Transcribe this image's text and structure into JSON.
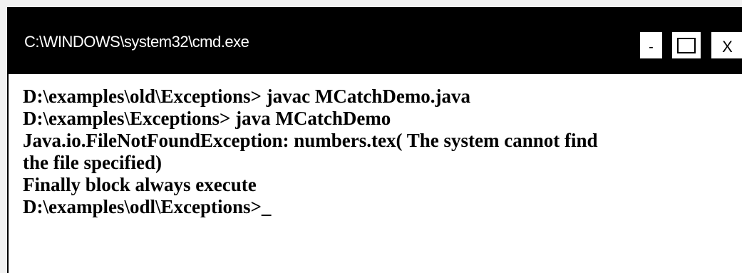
{
  "window": {
    "title": "C:\\WINDOWS\\system32\\cmd.exe",
    "controls": {
      "minimize_label": "-",
      "close_label": "X"
    }
  },
  "console": {
    "lines": [
      "D:\\examples\\old\\Exceptions> javac MCatchDemo.java",
      "D:\\examples\\Exceptions> java MCatchDemo",
      "Java.io.FileNotFoundException: numbers.tex( The system cannot find",
      "the file specified)",
      "Finally block always execute",
      "D:\\examples\\odl\\Exceptions>_"
    ]
  },
  "colors": {
    "titlebar_background": "#000000",
    "title_text": "#ffffff",
    "console_background": "#ffffff",
    "console_text": "#000000"
  }
}
